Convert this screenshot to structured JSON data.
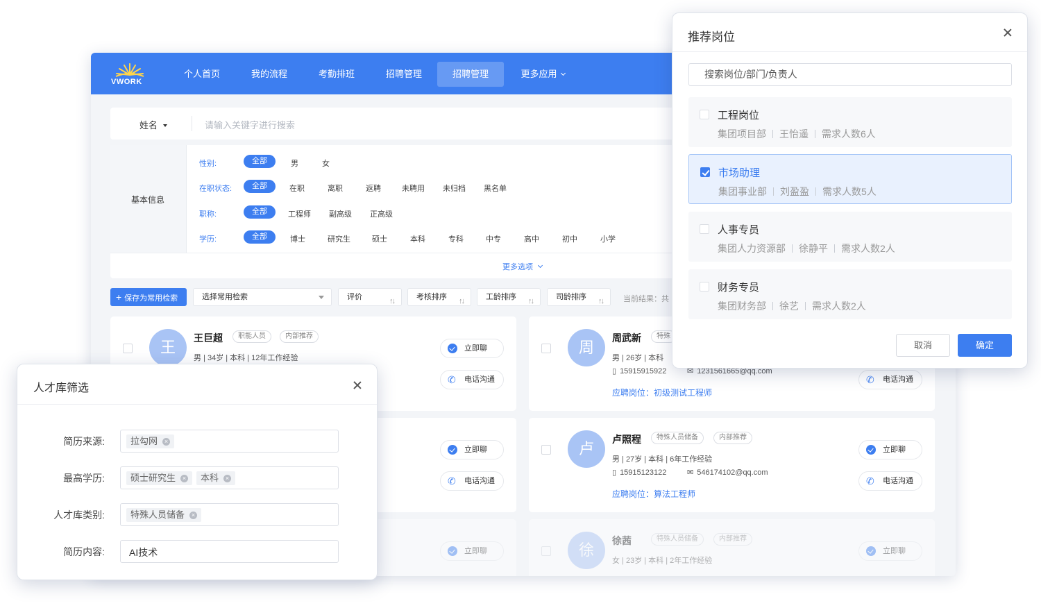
{
  "nav": {
    "logo": "VWORK",
    "items": [
      "个人首页",
      "我的流程",
      "考勤排班",
      "招聘管理",
      "招聘管理",
      "更多应用"
    ]
  },
  "search": {
    "field": "姓名",
    "placeholder": "请输入关键字进行搜索"
  },
  "filters": {
    "section_label": "基本信息",
    "rows": [
      {
        "key": "性别:",
        "selected": "全部",
        "options": [
          "男",
          "女"
        ]
      },
      {
        "key": "在职状态:",
        "selected": "全部",
        "options": [
          "在职",
          "离职",
          "返聘",
          "未聘用",
          "未归档",
          "黑名单"
        ]
      },
      {
        "key": "职称:",
        "selected": "全部",
        "options": [
          "工程师",
          "副高级",
          "正高级"
        ]
      },
      {
        "key": "学历:",
        "selected": "全部",
        "options": [
          "博士",
          "研究生",
          "硕士",
          "本科",
          "专科",
          "中专",
          "高中",
          "初中",
          "小学"
        ]
      }
    ],
    "more": "更多选项"
  },
  "toolbar": {
    "save": "保存为常用检索",
    "common_search": "选择常用检索",
    "sorts": [
      "评价",
      "考核排序",
      "工龄排序",
      "司龄排序"
    ],
    "result": "当前结果：共"
  },
  "actions": {
    "chat": "立即聊",
    "call": "电话沟通"
  },
  "candidates": [
    {
      "avatar": "王",
      "name": "王巨超",
      "tags": [
        "职能人员",
        "内部推荐"
      ],
      "info": "男 | 34岁 | 本科 | 12年工作经验"
    },
    {
      "avatar": "周",
      "name": "周武新",
      "tags": [
        "特殊"
      ],
      "info": "男 | 26岁 | 本科",
      "phone": "15915915922",
      "email": "1231561665@qq.com",
      "position_label": "应聘岗位：",
      "position": "初级测试工程师"
    },
    {
      "avatar": "卢",
      "name": "卢照程",
      "tags": [
        "特殊人员储备",
        "内部推荐"
      ],
      "info": "男 | 27岁 | 本科 | 6年工作经验",
      "phone": "15915123122",
      "email": "546174102@qq.com",
      "position_label": "应聘岗位：",
      "position": "算法工程师"
    },
    {
      "avatar": "徐",
      "name": "徐茜",
      "tags": [
        "特殊人员储备",
        "内部推荐"
      ],
      "info": "女 | 23岁 | 本科 | 2年工作经验"
    }
  ],
  "recommend_modal": {
    "title": "推荐岗位",
    "search_placeholder": "搜索岗位/部门/负责人",
    "items": [
      {
        "name": "工程岗位",
        "dept": "集团项目部",
        "owner": "王怡遥",
        "need": "需求人数6人",
        "checked": false
      },
      {
        "name": "市场助理",
        "dept": "集团事业部",
        "owner": "刘盈盈",
        "need": "需求人数5人",
        "checked": true
      },
      {
        "name": "人事专员",
        "dept": "集团人力资源部",
        "owner": "徐静平",
        "need": "需求人数2人",
        "checked": false
      },
      {
        "name": "财务专员",
        "dept": "集团财务部",
        "owner": "徐艺",
        "need": "需求人数2人",
        "checked": false
      }
    ],
    "cancel": "取消",
    "confirm": "确定"
  },
  "talent_modal": {
    "title": "人才库筛选",
    "fields": [
      {
        "label": "简历来源:",
        "chips": [
          "拉勾网"
        ]
      },
      {
        "label": "最高学历:",
        "chips": [
          "硕士研究生",
          "本科"
        ]
      },
      {
        "label": "人才库类别:",
        "chips": [
          "特殊人员储备"
        ]
      },
      {
        "label": "简历内容:",
        "value": "AI技术"
      }
    ]
  },
  "colors": {
    "primary": "#3d7ef0",
    "avatar": "#a9c4f5"
  }
}
